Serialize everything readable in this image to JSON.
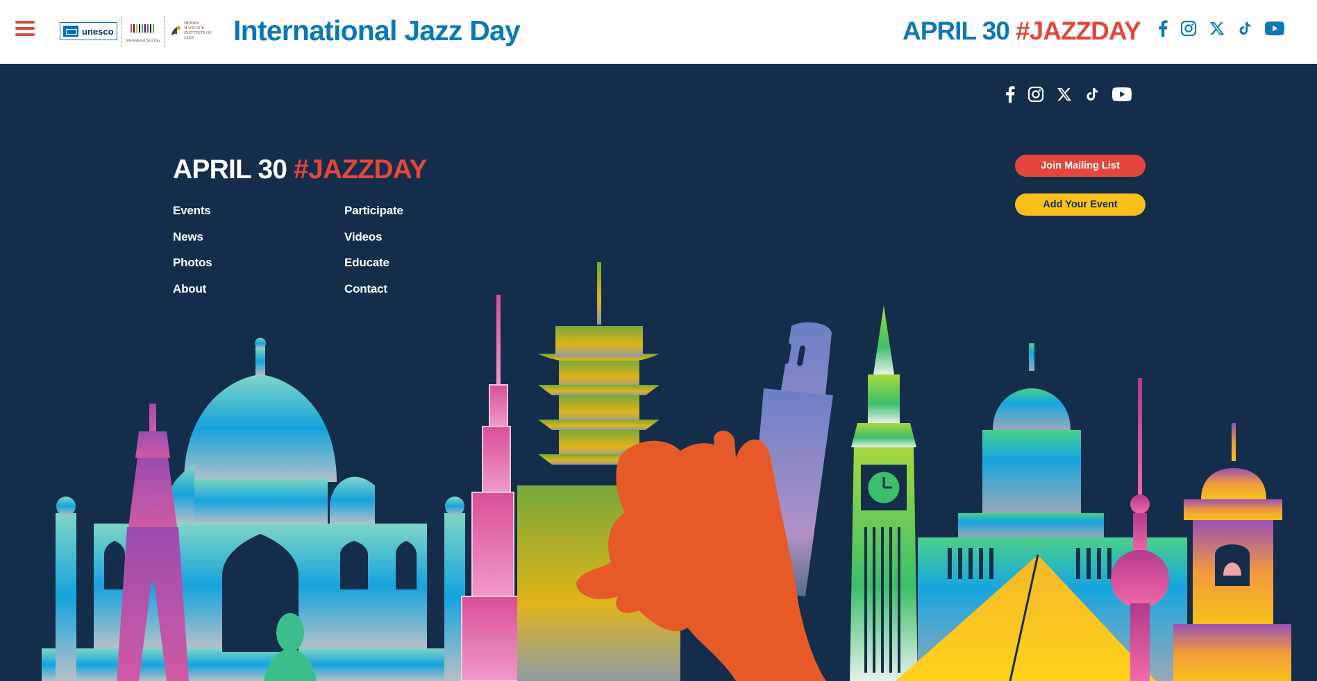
{
  "header": {
    "menu_icon": "hamburger-menu-icon",
    "logos": {
      "unesco": "unesco",
      "jazz_day_caption": "International Jazz Day",
      "hhi_line1": "HERBIE HANCOCK",
      "hhi_line2": "INSTITUTE OF JAZZ"
    },
    "site_title": "International Jazz Day",
    "date_text": "APRIL 30",
    "hashtag": "#JAZZDAY",
    "social_icons": [
      "facebook-icon",
      "instagram-icon",
      "x-icon",
      "tiktok-icon",
      "youtube-icon"
    ]
  },
  "footer": {
    "date_text": "APRIL 30",
    "hashtag": "#JAZZDAY",
    "nav_col1": [
      "Events",
      "News",
      "Photos",
      "About"
    ],
    "nav_col2": [
      "Participate",
      "Videos",
      "Educate",
      "Contact"
    ],
    "buttons": {
      "mailing": "Join Mailing List",
      "add_event": "Add Your Event"
    },
    "social_icons": [
      "facebook-icon",
      "instagram-icon",
      "x-icon",
      "tiktok-icon",
      "youtube-icon"
    ]
  },
  "colors": {
    "brand_blue": "#0b78b8",
    "hashtag_red": "#e5463b",
    "footer_bg": "#132d4b",
    "button_yellow": "#f9c01a"
  },
  "illustration": {
    "landmarks": [
      "Taj Mahal",
      "Eiffel Tower",
      "Burj Khalifa",
      "Pagoda",
      "Bronze Horseman",
      "Leaning Tower of Pisa",
      "Big Ben",
      "US Capitol",
      "Louvre Pyramid",
      "Oriental Pearl Tower",
      "Bell Tower"
    ]
  }
}
